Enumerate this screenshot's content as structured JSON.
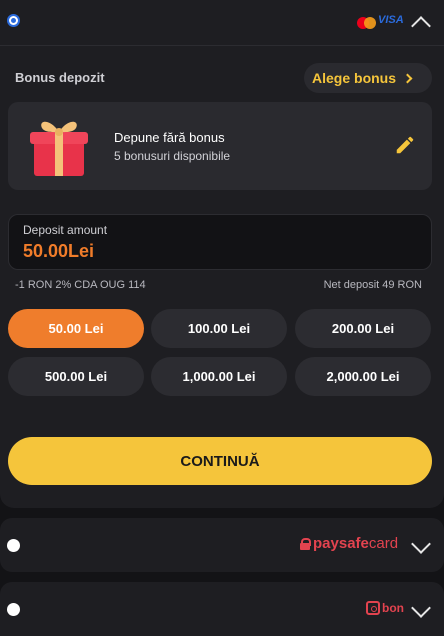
{
  "payment_methods": {
    "card": {
      "logo_mastercard": "mastercard-logo",
      "logo_visa_text": "VISA",
      "expanded": true
    },
    "paysafecard": {
      "logo_bold": "paysafe",
      "logo_regular": "card",
      "expanded": false
    },
    "abon": {
      "logo_text": "bon",
      "expanded": false
    }
  },
  "bonus": {
    "section_label": "Bonus depozit",
    "choose_label": "Alege bonus",
    "title": "Depune fără bonus",
    "subtitle": "5 bonusuri disponibile"
  },
  "deposit": {
    "label": "Deposit amount",
    "value": "50.00",
    "currency": "Lei",
    "fee_note": "-1 RON 2% CDA OUG 114",
    "net_note": "Net deposit 49 RON"
  },
  "amount_options": [
    "50.00 Lei",
    "100.00 Lei",
    "200.00 Lei",
    "500.00 Lei",
    "1,000.00 Lei",
    "2,000.00 Lei"
  ],
  "continue_label": "CONTINUĂ",
  "colors": {
    "accent_orange": "#ef7d2c",
    "button_yellow": "#f5c53b",
    "brand_red": "#e2434f",
    "radio_blue": "#2b6bdc"
  }
}
